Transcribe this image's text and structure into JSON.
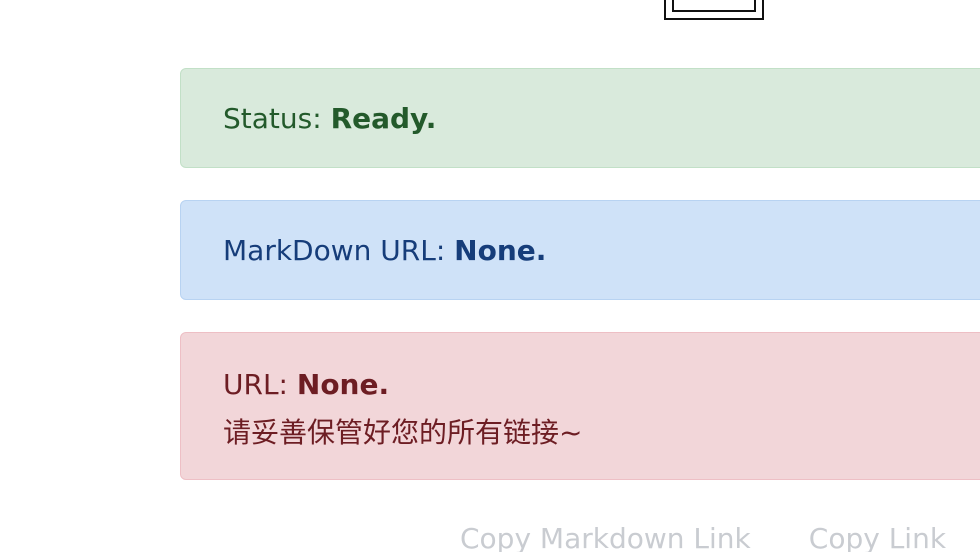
{
  "status": {
    "label": "Status: ",
    "value": "Ready."
  },
  "markdown": {
    "label": "MarkDown URL: ",
    "value": "None."
  },
  "url": {
    "label": "URL: ",
    "value": "None.",
    "note": "请妥善保管好您的所有链接~"
  },
  "buttons": {
    "copy_markdown": "Copy Markdown Link",
    "copy_link": "Copy Link"
  },
  "colors": {
    "success_bg": "#d9eadc",
    "info_bg": "#cfe2f8",
    "danger_bg": "#f2d6d9"
  }
}
